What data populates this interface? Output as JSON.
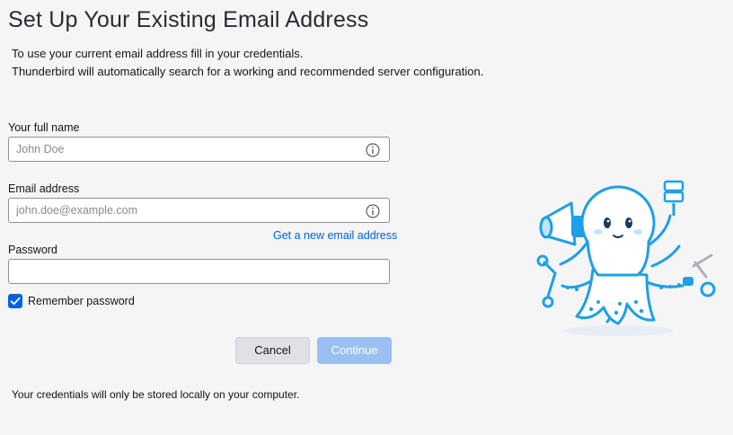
{
  "header": {
    "title": "Set Up Your Existing Email Address",
    "intro_line1": "To use your current email address fill in your credentials.",
    "intro_line2": "Thunderbird will automatically search for a working and recommended server configuration."
  },
  "form": {
    "full_name": {
      "label": "Your full name",
      "placeholder": "John Doe",
      "value": ""
    },
    "email": {
      "label": "Email address",
      "placeholder": "john.doe@example.com",
      "value": ""
    },
    "new_email_link": "Get a new email address",
    "password": {
      "label": "Password",
      "placeholder": "",
      "value": ""
    },
    "remember_password": {
      "label": "Remember password",
      "checked": true
    }
  },
  "buttons": {
    "cancel": "Cancel",
    "continue": "Continue"
  },
  "footer": {
    "note": "Your credentials will only be stored locally on your computer."
  },
  "colors": {
    "accent": "#0061e0",
    "continue_disabled": "#99c0f0",
    "mascot_blue": "#1ea0e6"
  },
  "icons": {
    "info": "info-icon",
    "check": "checkmark-icon",
    "mascot": "octopus-mascot"
  }
}
